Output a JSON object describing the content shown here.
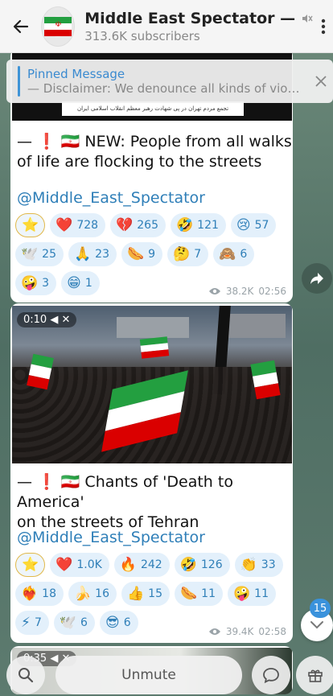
{
  "header": {
    "title": "Middle East Spectator —",
    "subscribers": "313.6K subscribers"
  },
  "pinned": {
    "title": "Pinned Message",
    "text": "— Disclaimer:   We denounce all kinds of viole..."
  },
  "messages": [
    {
      "thumb_caption": "تجمع مردم تهران در پی شهادت رهبر معظم انقلاب اسلامی ایران",
      "text_line1": "— ❗ 🇮🇷 NEW: People from all walks",
      "text_line2": "of life are flocking to the streets",
      "link": "@Middle_East_Spectator",
      "reactions": [
        {
          "emoji": "⭐",
          "count": ""
        },
        {
          "emoji": "❤️",
          "count": "728"
        },
        {
          "emoji": "💔",
          "count": "265"
        },
        {
          "emoji": "🤣",
          "count": "121"
        },
        {
          "emoji": "😢",
          "count": "57"
        },
        {
          "emoji": "🕊️",
          "count": "25"
        },
        {
          "emoji": "🙏",
          "count": "23"
        },
        {
          "emoji": "🌭",
          "count": "9"
        },
        {
          "emoji": "🤔",
          "count": "7"
        },
        {
          "emoji": "🙈",
          "count": "6"
        },
        {
          "emoji": "🤪",
          "count": "3"
        },
        {
          "emoji": "😁",
          "count": "1"
        }
      ],
      "views": "38.2K",
      "time": "02:56"
    },
    {
      "video_time": "0:10",
      "text_line1": "— ❗ 🇮🇷 Chants of 'Death to America'",
      "text_line2": "on the streets of Tehran",
      "link": "@Middle_East_Spectator",
      "reactions": [
        {
          "emoji": "⭐",
          "count": ""
        },
        {
          "emoji": "❤️",
          "count": "1.0K"
        },
        {
          "emoji": "🔥",
          "count": "242"
        },
        {
          "emoji": "🤣",
          "count": "126"
        },
        {
          "emoji": "👏",
          "count": "33"
        },
        {
          "emoji": "❤️‍🔥",
          "count": "18"
        },
        {
          "emoji": "🍌",
          "count": "16"
        },
        {
          "emoji": "👍",
          "count": "15"
        },
        {
          "emoji": "🌭",
          "count": "11"
        },
        {
          "emoji": "🤪",
          "count": "11"
        },
        {
          "emoji": "⚡",
          "count": "7"
        },
        {
          "emoji": "🕊️",
          "count": "6"
        },
        {
          "emoji": "😎",
          "count": "6"
        }
      ],
      "views": "39.4K",
      "time": "02:58"
    },
    {
      "video_time": "0:35"
    }
  ],
  "unread_count": "15",
  "bottom": {
    "unmute_label": "Unmute"
  },
  "colors": {
    "accent": "#3a92dc",
    "link": "#2f7fb8",
    "reaction_bg": "#e3f0fb"
  }
}
